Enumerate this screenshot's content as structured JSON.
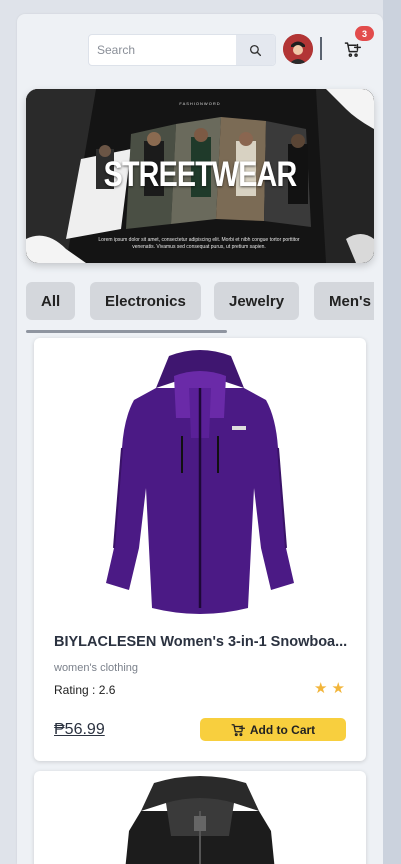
{
  "header": {
    "search_placeholder": "Search",
    "cart_count": "3"
  },
  "banner": {
    "brand": "FASHIONWORD",
    "title": "STREETWEAR",
    "body": "Lorem ipsum dolor sit amet, consectetur adipiscing elit. Morbi et nibh congue tortor porttitor venenatis. Vivamus sed consequat purus, ut pretium sapien."
  },
  "categories": [
    "All",
    "Electronics",
    "Jewelry",
    "Men's"
  ],
  "products": [
    {
      "title": "BIYLACLESEN Women's 3-in-1 Snowboa...",
      "category": "women's clothing",
      "rating_label": "Rating : 2.6",
      "rating": 2.6,
      "stars_shown": 2,
      "price": "₱56.99",
      "button_label": "Add to Cart",
      "image": "purple-jacket"
    },
    {
      "image": "black-jacket"
    }
  ],
  "icons": {
    "search": "search-icon",
    "cart": "cart-plus-icon",
    "star": "star-icon"
  },
  "colors": {
    "accent_yellow": "#f8cf3e",
    "badge_red": "#e24c4c",
    "star": "#f2b53a"
  }
}
